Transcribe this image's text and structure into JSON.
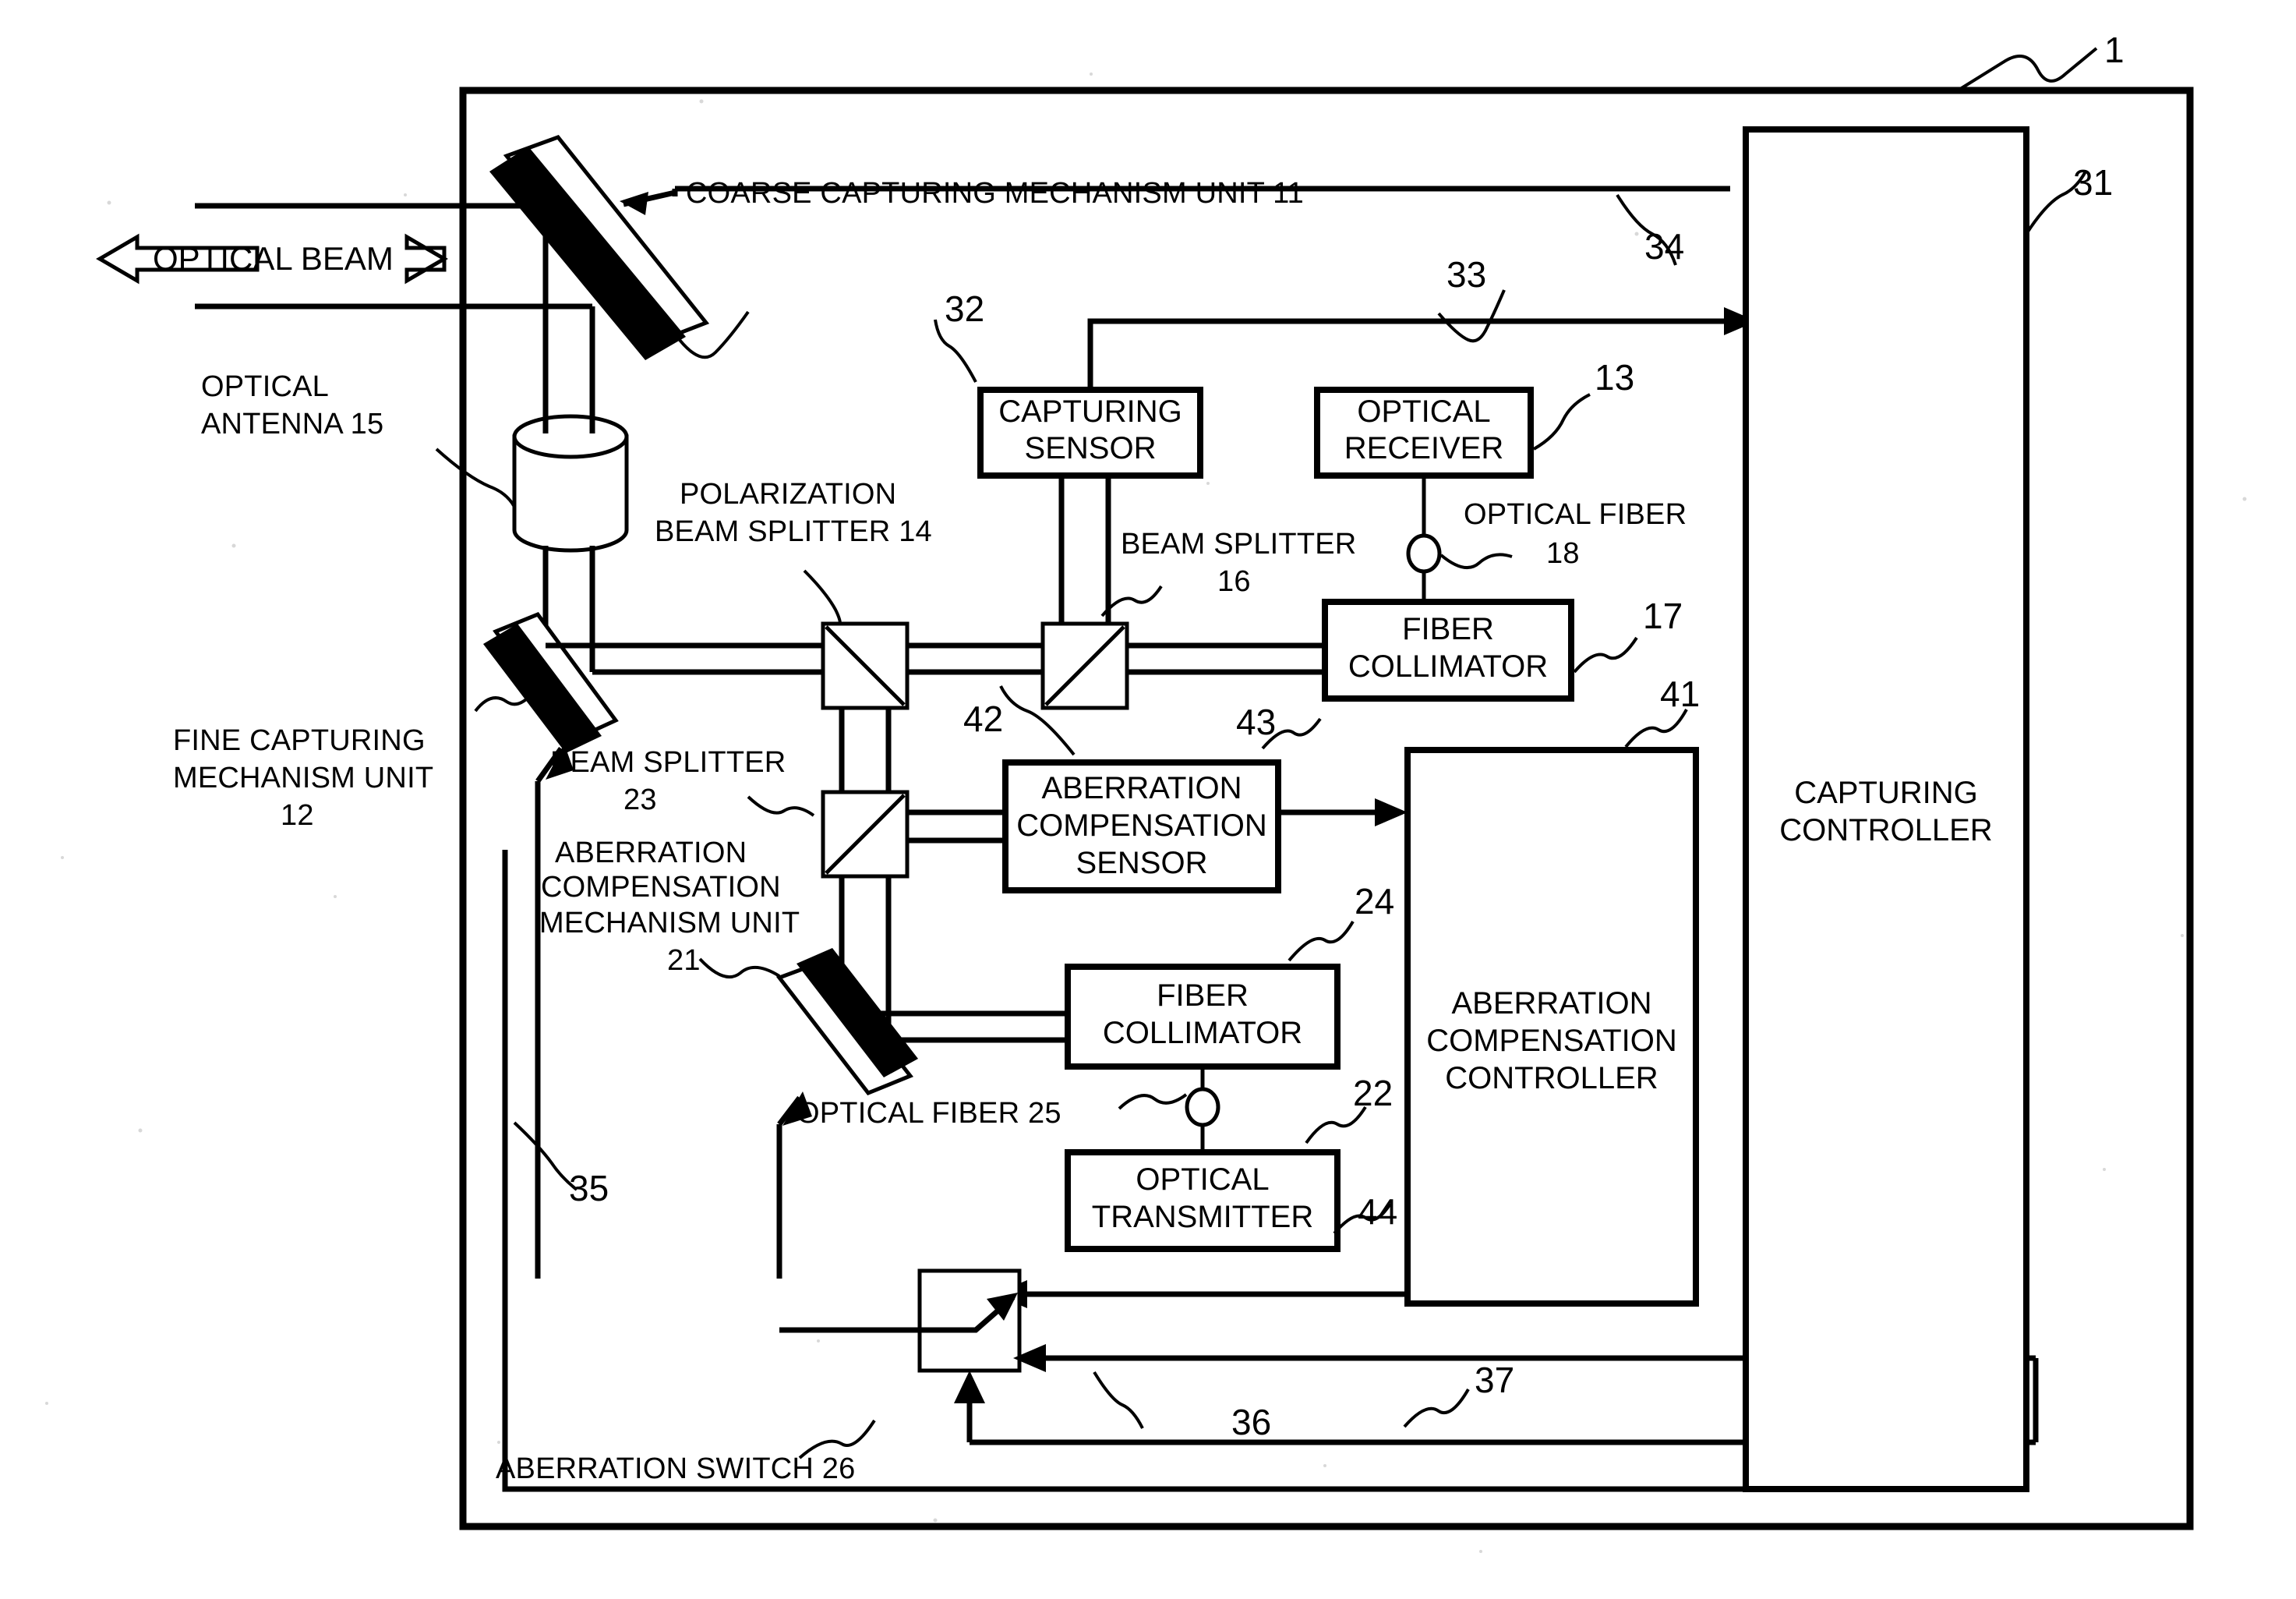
{
  "figure": {
    "type": "patent-block-diagram",
    "title_numeral": "1",
    "background_color": "#ffffff",
    "line_color": "#000000"
  },
  "beam": {
    "label": "OPTICAL BEAM",
    "left_arrow": "⇦",
    "right_arrow": "⇨"
  },
  "labels": {
    "coarse_capturing": "COARSE CAPTURING MECHANISM UNIT 11",
    "optical_antenna": "OPTICAL",
    "optical_antenna2": "ANTENNA 15",
    "polarization_bs1": "POLARIZATION",
    "polarization_bs2": "BEAM SPLITTER 14",
    "beam_splitter_16a": "BEAM SPLITTER",
    "beam_splitter_16b": "16",
    "optical_fiber_18a": "OPTICAL FIBER",
    "optical_fiber_18b": "18",
    "fine_capturing1": "FINE CAPTURING",
    "fine_capturing2": "MECHANISM UNIT",
    "fine_capturing3": "12",
    "beam_splitter_23a": "BEAM SPLITTER",
    "beam_splitter_23b": "23",
    "aberr_mech1": "ABERRATION",
    "aberr_mech2": "COMPENSATION",
    "aberr_mech3": "MECHANISM UNIT",
    "aberr_mech4": "21",
    "optical_fiber_25": "OPTICAL FIBER 25",
    "aberration_switch_26": "ABERRATION SWITCH 26"
  },
  "boxes": {
    "capturing_sensor": {
      "lines": [
        "CAPTURING",
        "SENSOR"
      ],
      "ref": "32"
    },
    "optical_receiver": {
      "lines": [
        "OPTICAL",
        "RECEIVER"
      ],
      "ref": "13"
    },
    "fiber_collimator_17": {
      "lines": [
        "FIBER",
        "COLLIMATOR"
      ],
      "ref": "17"
    },
    "aberration_compensation_sensor": {
      "lines": [
        "ABERRATION",
        "COMPENSATION",
        "SENSOR"
      ],
      "ref": ""
    },
    "fiber_collimator_24": {
      "lines": [
        "FIBER",
        "COLLIMATOR"
      ],
      "ref": "24"
    },
    "optical_transmitter": {
      "lines": [
        "OPTICAL",
        "TRANSMITTER"
      ],
      "ref": "22"
    },
    "aberration_compensation_controller": {
      "lines": [
        "ABERRATION",
        "COMPENSATION",
        "CONTROLLER"
      ],
      "ref": "41"
    },
    "capturing_controller": {
      "lines": [
        "CAPTURING",
        "CONTROLLER"
      ],
      "ref": "31"
    }
  },
  "reference_numerals": {
    "device": "1",
    "capturing_controller": "31",
    "capturing_sensor": "32",
    "signal_33": "33",
    "signal_34": "34",
    "signal_35": "35",
    "signal_36": "36",
    "signal_37": "37",
    "signal_41": "41",
    "signal_42": "42",
    "signal_43": "43",
    "signal_44": "44",
    "optical_receiver": "13",
    "fiber_collimator": "17",
    "fiber_collimator_tx": "24",
    "optical_transmitter": "22"
  }
}
